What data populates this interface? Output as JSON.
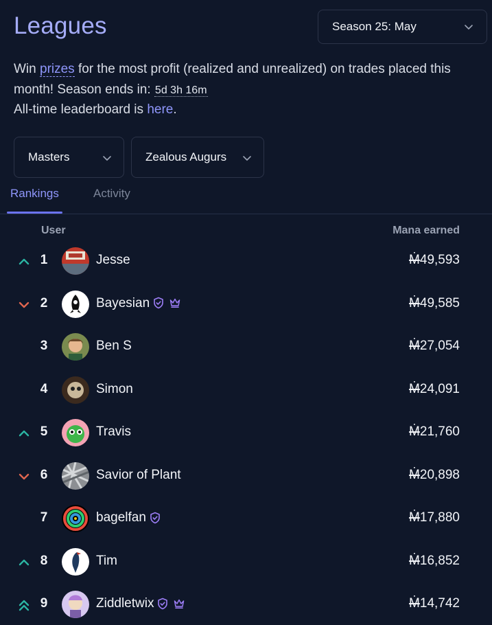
{
  "header": {
    "title": "Leagues",
    "season_select": "Season 25: May",
    "desc_win": "Win ",
    "desc_prizes": "prizes",
    "desc_rest": " for the most profit (realized and unrealized) on trades placed this month! Season ends in: ",
    "countdown": "5d 3h 16m",
    "alltime_pre": "All-time leaderboard is ",
    "alltime_link": "here",
    "alltime_post": "."
  },
  "filters": {
    "division": "Masters",
    "cohort": "Zealous Augurs"
  },
  "tabs": [
    {
      "label": "Rankings",
      "active": true
    },
    {
      "label": "Activity",
      "active": false
    }
  ],
  "table": {
    "col_user": "User",
    "col_mana": "Mana earned",
    "currency_symbol": "Ṁ",
    "rows": [
      {
        "rank": "1",
        "name": "Jesse",
        "amount": "49,593",
        "trend": "up",
        "badges": []
      },
      {
        "rank": "2",
        "name": "Bayesian",
        "amount": "49,585",
        "trend": "down",
        "badges": [
          "shield-check-icon",
          "crown-icon"
        ]
      },
      {
        "rank": "3",
        "name": "Ben S",
        "amount": "27,054",
        "trend": "none",
        "badges": []
      },
      {
        "rank": "4",
        "name": "Simon",
        "amount": "24,091",
        "trend": "none",
        "badges": []
      },
      {
        "rank": "5",
        "name": "Travis",
        "amount": "21,760",
        "trend": "up",
        "badges": []
      },
      {
        "rank": "6",
        "name": "Savior of Plant",
        "amount": "20,898",
        "trend": "down",
        "badges": []
      },
      {
        "rank": "7",
        "name": "bagelfan",
        "amount": "17,880",
        "trend": "none",
        "badges": [
          "shield-check-icon"
        ]
      },
      {
        "rank": "8",
        "name": "Tim",
        "amount": "16,852",
        "trend": "up",
        "badges": []
      },
      {
        "rank": "9",
        "name": "Ziddletwix",
        "amount": "14,742",
        "trend": "double-up",
        "badges": [
          "shield-check-icon",
          "crown-icon"
        ]
      }
    ]
  },
  "colors": {
    "background": "#0f1729",
    "accent": "#8f96fb",
    "trend_up": "#2bb5a3",
    "trend_down": "#e0664f",
    "badge": "#9d7ef7"
  }
}
